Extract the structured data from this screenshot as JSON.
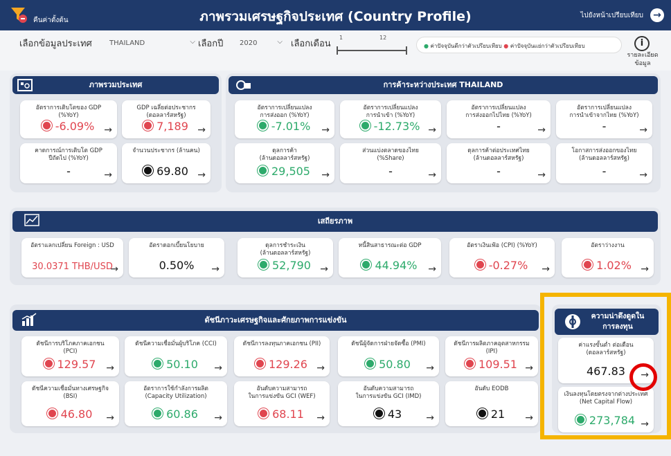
{
  "header": {
    "reset_label": "คืนค่าตั้งต้น",
    "title": "ภาพรวมเศรษฐกิจประเทศ (Country Profile)",
    "compare_label": "ไปยังหน้าเปรียบเทียบ",
    "compare_icon": "→"
  },
  "filters": {
    "country_label": "เลือกข้อมูลประเทศ",
    "country_value": "THAILAND",
    "year_label": "เลือกปี",
    "year_value": "2020",
    "month_label": "เลือกเดือน",
    "month_min": "1",
    "month_max": "12",
    "chevron": "⌵",
    "legend_better": "ค่าปัจจุบันดีกว่าตัวเปรียบเทียบ",
    "legend_worse": "ค่าปัจจุบันแย่กว่าตัวเปรียบเทียบ",
    "legend_dot": "●",
    "info_icon": "i",
    "info_label_1": "รายละเอียด",
    "info_label_2": "ข้อมูล"
  },
  "arrow": "→",
  "colors": {
    "green": "#2daa6b",
    "red": "#e0454f",
    "navy": "#1f3a6b",
    "highlight": "#f5b400"
  },
  "overview": {
    "title": "ภาพรวมประเทศ",
    "cards": [
      {
        "l1": "อัตราการเติบโตของ GDP",
        "l2": "(%YoY)",
        "value": "-6.09%",
        "status": "r"
      },
      {
        "l1": "GDP เฉลี่ยต่อประชากร",
        "l2": "(ดอลลาร์สหรัฐ)",
        "value": "7,189",
        "status": "r"
      },
      {
        "l1": "คาดการณ์การเติบโต GDP",
        "l2": "ปีถัดไป (%YoY)",
        "value": "-",
        "status": "b"
      },
      {
        "l1": "จำนวนประชากร (ล้านคน)",
        "l2": "",
        "value": "69.80",
        "status": "b"
      }
    ]
  },
  "trade": {
    "title": "การค้าระหว่างประเทศ THAILAND",
    "cards": [
      {
        "l1": "อัตราการเปลี่ยนแปลง",
        "l2": "การส่งออก (%YoY)",
        "value": "-7.01%",
        "status": "g"
      },
      {
        "l1": "อัตราการเปลี่ยนแปลง",
        "l2": "การนำเข้า (%YoY)",
        "value": "-12.73%",
        "status": "g"
      },
      {
        "l1": "อัตราการเปลี่ยนแปลง",
        "l2": "การส่งออกไปไทย (%YoY)",
        "value": "-",
        "status": "b"
      },
      {
        "l1": "อัตราการเปลี่ยนแปลง",
        "l2": "การนำเข้าจากไทย (%YoY)",
        "value": "-",
        "status": "b"
      },
      {
        "l1": "ดุลการค้า",
        "l2": "(ล้านดอลลาร์สหรัฐ)",
        "value": "29,505",
        "status": "g"
      },
      {
        "l1": "ส่วนแบ่งตลาดของไทย",
        "l2": "(%Share)",
        "value": "-",
        "status": "b"
      },
      {
        "l1": "ดุลการค้าต่อประเทศไทย",
        "l2": "(ล้านดอลลาร์สหรัฐ)",
        "value": "-",
        "status": "b"
      },
      {
        "l1": "โอกาสการส่งออกของไทย",
        "l2": "(ล้านดอลลาร์สหรัฐ)",
        "value": "-",
        "status": "b"
      }
    ]
  },
  "stability": {
    "title": "เสถียรภาพ",
    "cards": [
      {
        "l1": "อัตราแลกเปลี่ยน Foreign : USD",
        "l2": "",
        "value": "30.0371 THB/USD",
        "status": "r"
      },
      {
        "l1": "อัตราดอกเบี้ยนโยบาย",
        "l2": "",
        "value": "0.50%",
        "status": "b"
      },
      {
        "l1": "ดุลการชำระเงิน",
        "l2": "(ล้านดอลลาร์สหรัฐ)",
        "value": "52,790",
        "status": "g"
      },
      {
        "l1": "หนี้สินสาธารณะต่อ GDP",
        "l2": "",
        "value": "44.94%",
        "status": "g"
      },
      {
        "l1": "อัตราเงินเฟ้อ (CPI) (%YoY)",
        "l2": "",
        "value": "-0.27%",
        "status": "r"
      },
      {
        "l1": "อัตราว่างงาน",
        "l2": "",
        "value": "1.02%",
        "status": "r"
      }
    ]
  },
  "competitiveness": {
    "title": "ดัชนีภาวะเศรษฐกิจและศักยภาพการแข่งขัน",
    "cards": [
      {
        "l1": "ดัชนีการบริโภคภาคเอกชน",
        "l2": "(PCI)",
        "value": "129.57",
        "status": "r"
      },
      {
        "l1": "ดัชนีความเชื่อมั่นผู้บริโภค (CCI)",
        "l2": "",
        "value": "50.10",
        "status": "g"
      },
      {
        "l1": "ดัชนีการลงทุนภาคเอกชน (PII)",
        "l2": "",
        "value": "129.26",
        "status": "r"
      },
      {
        "l1": "ดัชนีผู้จัดการฝ่ายจัดซื้อ (PMI)",
        "l2": "",
        "value": "50.80",
        "status": "g"
      },
      {
        "l1": "ดัชนีการผลิตภาคอุตสาหกรรม",
        "l2": "(IPI)",
        "value": "109.51",
        "status": "r"
      },
      {
        "l1": "ดัชนีความเชื่อมั่นทางเศรษฐกิจ",
        "l2": "(BSI)",
        "value": "46.80",
        "status": "r"
      },
      {
        "l1": "อัตราการใช้กำลังการผลิต",
        "l2": "(Capacity Utilization)",
        "value": "60.86",
        "status": "g"
      },
      {
        "l1": "อันดับความสามารถ",
        "l2": "ในการแข่งขัน GCI (WEF)",
        "value": "68.11",
        "status": "r"
      },
      {
        "l1": "อันดับความสามารถ",
        "l2": "ในการแข่งขัน GCI (IMD)",
        "value": "43",
        "status": "b"
      },
      {
        "l1": "อันดับ EODB",
        "l2": "",
        "value": "21",
        "status": "b"
      }
    ]
  },
  "investment": {
    "title_1": "ความน่าดึงดูดใน",
    "title_2": "การลงทุน",
    "cards": [
      {
        "l1": "ค่าแรงขั้นต่ำ ต่อเดือน",
        "l2": "(ดอลลาร์สหรัฐ)",
        "value": "467.83",
        "status": "b",
        "nodot": true
      },
      {
        "l1": "เงินลงทุนโดยตรงจากต่างประเทศ",
        "l2": "(Net Capital Flow)",
        "value": "273,784",
        "status": "g"
      }
    ]
  }
}
